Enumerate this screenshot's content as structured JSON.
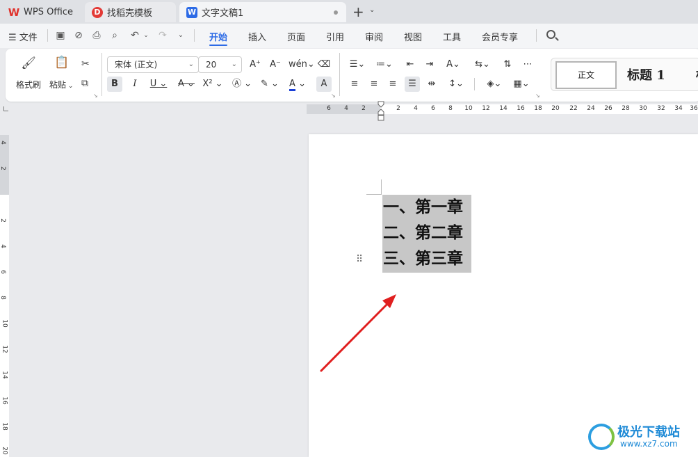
{
  "tabs": [
    {
      "label": "WPS Office",
      "icon": "wps-logo-icon"
    },
    {
      "label": "找稻壳模板",
      "icon": "docer-icon"
    },
    {
      "label": "文字文稿1",
      "icon": "writer-doc-icon"
    }
  ],
  "menu": {
    "file_label": "文件",
    "tabs": [
      "开始",
      "插入",
      "页面",
      "引用",
      "审阅",
      "视图",
      "工具",
      "会员专享"
    ],
    "active_tab": "开始"
  },
  "ribbon": {
    "format_painter": "格式刷",
    "paste": "粘贴",
    "font_name": "宋体 (正文)",
    "font_size": "20",
    "styles": {
      "normal": "正文",
      "heading1": "标题 1",
      "heading2_partial": "标"
    }
  },
  "ruler": {
    "horizontal": [
      "6",
      "4",
      "2",
      "2",
      "4",
      "6",
      "8",
      "10",
      "12",
      "14",
      "16",
      "18",
      "20",
      "22",
      "24",
      "26",
      "28",
      "30",
      "32",
      "34",
      "36"
    ],
    "vertical": [
      "4",
      "2",
      "2",
      "4",
      "6",
      "8",
      "10",
      "12",
      "14",
      "16",
      "18",
      "20"
    ]
  },
  "document": {
    "lines": [
      "一、第一章",
      "二、第二章",
      "三、第三章"
    ]
  },
  "watermark": {
    "name": "极光下载站",
    "url": "www.xz7.com"
  },
  "colors": {
    "accent": "#2d6be6",
    "selection": "#c7c7c7",
    "arrow": "#e01f1f",
    "font_color_bar": "#1a3fd6"
  }
}
